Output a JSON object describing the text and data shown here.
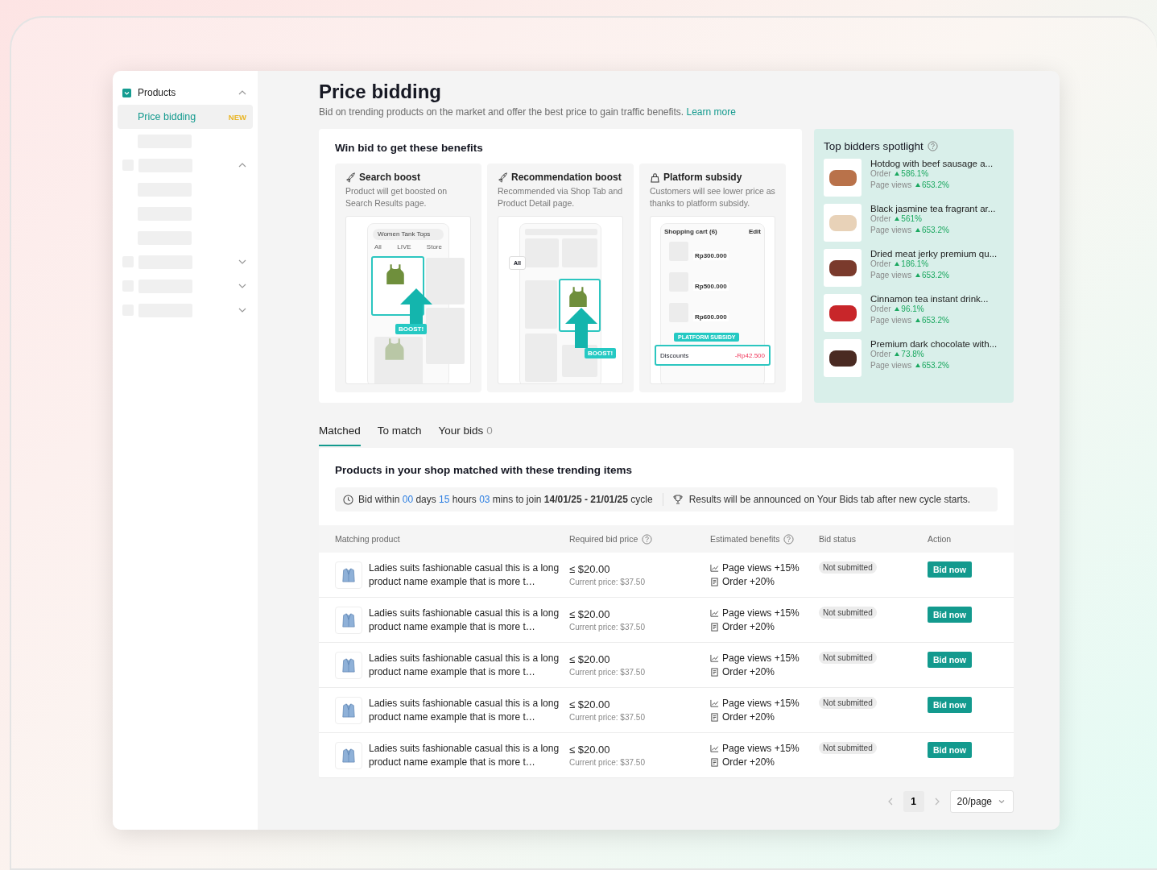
{
  "sidebar": {
    "groups": [
      {
        "kind": "menu",
        "label": "Products",
        "expanded": true,
        "children": [
          {
            "kind": "menu",
            "label": "Price bidding",
            "badge": "NEW",
            "selected": true
          },
          {
            "kind": "placeholder",
            "selected": false
          }
        ]
      },
      {
        "kind": "placeholder",
        "expanded": true,
        "children": [
          {
            "kind": "placeholder",
            "selected": false
          },
          {
            "kind": "placeholder",
            "selected": false
          },
          {
            "kind": "placeholder",
            "selected": false
          }
        ]
      },
      {
        "kind": "placeholder",
        "expanded": false
      },
      {
        "kind": "placeholder",
        "expanded": false
      },
      {
        "kind": "placeholder",
        "expanded": false
      }
    ]
  },
  "header": {
    "title": "Price bidding",
    "subtitle": "Bid on trending products on the market and offer the best price to gain traffic benefits.",
    "link": "Learn more"
  },
  "benefits": {
    "title": "Win bid to get these benefits",
    "cards": [
      {
        "kind": "search",
        "title": "Search boost",
        "description": "Product will get boosted on Search Results page.",
        "illustration": {
          "search_text": "Women Tank Tops",
          "tabs": [
            "All",
            "LIVE",
            "Store"
          ],
          "badge": "BOOST!"
        }
      },
      {
        "kind": "recommendation",
        "title": "Recommendation boost",
        "description": "Recommended via Shop Tab and Product Detail page.",
        "illustration": {
          "chip": "All",
          "badge": "BOOST!"
        }
      },
      {
        "kind": "subsidy",
        "title": "Platform subsidy",
        "description": "Customers will see lower price as thanks to platform subsidy.",
        "illustration": {
          "heading": "Shopping cart (6)",
          "edit": "Edit",
          "prices": [
            "Rp300.000",
            "Rp500.000",
            "Rp600.000"
          ],
          "badge": "PLATFORM SUBSIDY",
          "discount_label": "Discounts",
          "discount_value": "-Rp42.500"
        }
      }
    ]
  },
  "spotlight": {
    "title": "Top bidders spotlight",
    "items": [
      {
        "name": "Hotdog with beef sausage a...",
        "order_label": "Order",
        "order": "586.1%",
        "views_label": "Page views",
        "views": "653.2%"
      },
      {
        "name": "Black jasmine tea fragrant ar...",
        "order_label": "Order",
        "order": "561%",
        "views_label": "Page views",
        "views": "653.2%"
      },
      {
        "name": "Dried meat jerky premium qu...",
        "order_label": "Order",
        "order": "186.1%",
        "views_label": "Page views",
        "views": "653.2%"
      },
      {
        "name": "Cinnamon tea instant drink...",
        "order_label": "Order",
        "order": "96.1%",
        "views_label": "Page views",
        "views": "653.2%"
      },
      {
        "name": "Premium dark chocolate with...",
        "order_label": "Order",
        "order": "73.8%",
        "views_label": "Page views",
        "views": "653.2%"
      }
    ]
  },
  "tabs": [
    {
      "label": "Matched",
      "selected": true
    },
    {
      "label": "To match",
      "selected": false
    },
    {
      "label": "Your bids",
      "count": "0",
      "selected": false
    }
  ],
  "matched": {
    "title": "Products in your shop matched with these trending items",
    "timer": [
      {
        "kind": "text",
        "text": "Bid within "
      },
      {
        "kind": "number",
        "text": "00"
      },
      {
        "kind": "text",
        "text": " days "
      },
      {
        "kind": "number",
        "text": "15"
      },
      {
        "kind": "text",
        "text": " hours "
      },
      {
        "kind": "number",
        "text": "03"
      },
      {
        "kind": "text",
        "text": " mins to join "
      },
      {
        "kind": "bold",
        "text": "14/01/25 - 21/01/25"
      },
      {
        "kind": "text",
        "text": " cycle"
      }
    ],
    "notice": "Results will be announced on Your Bids tab after new cycle starts.",
    "columns": [
      {
        "label": "Matching product",
        "help": false
      },
      {
        "label": "Required bid price",
        "help": true
      },
      {
        "label": "Estimated benefits",
        "help": true
      },
      {
        "label": "Bid status",
        "help": false
      },
      {
        "label": "Action",
        "help": false
      }
    ],
    "rows": [
      {
        "product": "Ladies suits fashionable casual this is a long product name example that is more t…",
        "price": "≤ $20.00",
        "current_price": "Current price: $37.50",
        "benefits": [
          {
            "kind": "views",
            "text": "Page views +15%"
          },
          {
            "kind": "order",
            "text": "Order +20%"
          }
        ],
        "status": "Not submitted",
        "action": "Bid now"
      },
      {
        "product": "Ladies suits fashionable casual this is a long product name example that is more t…",
        "price": "≤ $20.00",
        "current_price": "Current price: $37.50",
        "benefits": [
          {
            "kind": "views",
            "text": "Page views +15%"
          },
          {
            "kind": "order",
            "text": "Order +20%"
          }
        ],
        "status": "Not submitted",
        "action": "Bid now"
      },
      {
        "product": "Ladies suits fashionable casual this is a long product name example that is more t…",
        "price": "≤ $20.00",
        "current_price": "Current price: $37.50",
        "benefits": [
          {
            "kind": "views",
            "text": "Page views +15%"
          },
          {
            "kind": "order",
            "text": "Order +20%"
          }
        ],
        "status": "Not submitted",
        "action": "Bid now"
      },
      {
        "product": "Ladies suits fashionable casual this is a long product name example that is more t…",
        "price": "≤ $20.00",
        "current_price": "Current price: $37.50",
        "benefits": [
          {
            "kind": "views",
            "text": "Page views +15%"
          },
          {
            "kind": "order",
            "text": "Order +20%"
          }
        ],
        "status": "Not submitted",
        "action": "Bid now"
      },
      {
        "product": "Ladies suits fashionable casual this is a long product name example that is more t…",
        "price": "≤ $20.00",
        "current_price": "Current price: $37.50",
        "benefits": [
          {
            "kind": "views",
            "text": "Page views +15%"
          },
          {
            "kind": "order",
            "text": "Order +20%"
          }
        ],
        "status": "Not submitted",
        "action": "Bid now"
      }
    ]
  },
  "pagination": {
    "pages": [
      {
        "label": "1",
        "selected": true
      }
    ],
    "page_size": "20/page"
  }
}
